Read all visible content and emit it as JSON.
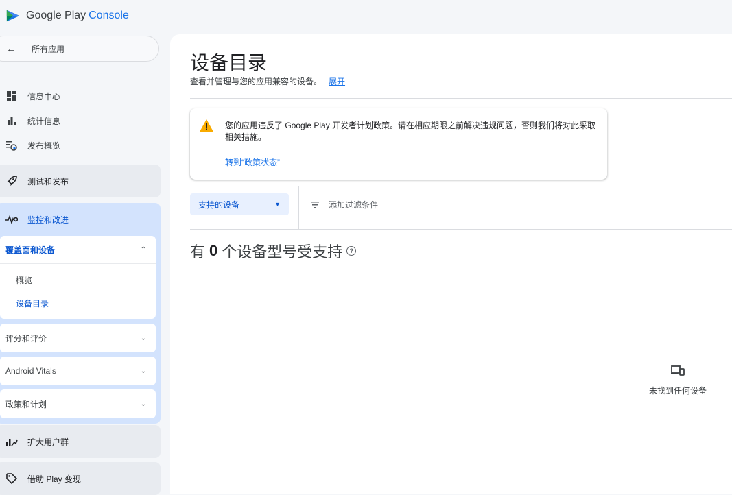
{
  "brand": {
    "name": "Google Play",
    "suffix": "Console"
  },
  "sidebar": {
    "all_apps": {
      "label": "所有应用"
    },
    "top_items": [
      {
        "label": "信息中心",
        "icon": "dashboard-icon"
      },
      {
        "label": "统计信息",
        "icon": "bar-chart-icon"
      },
      {
        "label": "发布概览",
        "icon": "release-overview-icon"
      }
    ],
    "test_release": {
      "label": "测试和发布",
      "icon": "rocket-icon"
    },
    "monitor": {
      "label": "监控和改进",
      "icon": "pulse-icon",
      "expanded_section": {
        "label": "覆盖面和设备",
        "items": [
          {
            "label": "概览"
          },
          {
            "label": "设备目录"
          }
        ]
      },
      "collapsed_sections": [
        {
          "label": "评分和评价"
        },
        {
          "label": "Android Vitals"
        },
        {
          "label": "政策和计划"
        }
      ]
    },
    "grow_users": {
      "label": "扩大用户群",
      "icon": "grow-users-icon"
    },
    "monetize": {
      "label": "借助 Play 变现",
      "icon": "tag-icon"
    }
  },
  "main": {
    "title": "设备目录",
    "subtitle": "查看并管理与您的应用兼容的设备。",
    "expand_label": "展开",
    "alert": {
      "message": "您的应用违反了 Google Play 开发者计划政策。请在相应期限之前解决违规问题，否则我们将对此采取相关措施。",
      "link": "转到“政策状态”"
    },
    "filter": {
      "dropdown_value": "支持的设备",
      "add_filter_label": "添加过滤条件"
    },
    "count": {
      "prefix": "有",
      "number": "0",
      "suffix": "个设备型号受支持"
    },
    "empty_state": "未找到任何设备"
  },
  "colors": {
    "accent": "#0b57d0",
    "warning": "#f9ab00",
    "link": "#1a73e8"
  }
}
